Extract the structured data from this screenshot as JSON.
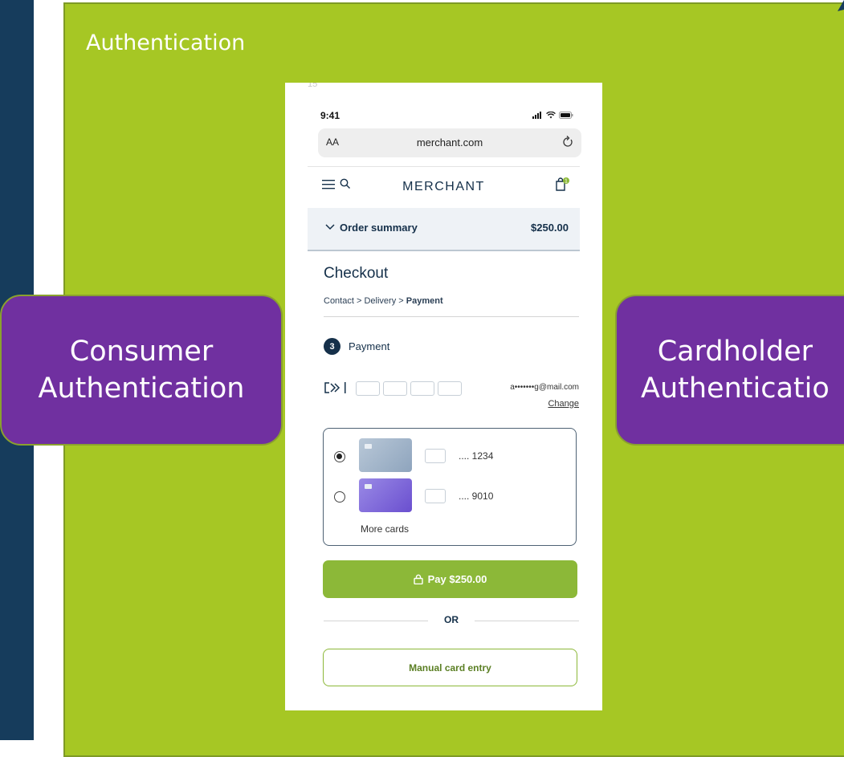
{
  "colors": {
    "left_band": "#163c5c",
    "panel": "#a6c724",
    "callout": "#7030a0",
    "pay_button": "#8cb838",
    "brand_text": "#15304a"
  },
  "slide": {
    "title": "Authentication",
    "left_callout": [
      "Consumer",
      "Authentication"
    ],
    "right_callout": [
      "Cardholder",
      "Authenticatio"
    ]
  },
  "phone": {
    "page_number": "15",
    "status_time": "9:41",
    "status_icons": [
      "signal-icon",
      "wifi-icon",
      "battery-icon"
    ],
    "url": {
      "aa": "AA",
      "domain": "merchant.com"
    },
    "header": {
      "logo": "MERCHANT"
    },
    "order_summary": {
      "label": "Order summary",
      "amount": "$250.00"
    },
    "checkout": {
      "title": "Checkout",
      "breadcrumb_1": "Contact",
      "breadcrumb_2": "Delivery",
      "breadcrumb_active": "Payment",
      "separator": ">"
    },
    "step": {
      "number": "3",
      "label": "Payment"
    },
    "click_to_pay": {
      "email": "a•••••••g@mail.com",
      "change": "Change"
    },
    "cards": [
      {
        "number": ".... 1234",
        "selected": true,
        "color": "#9fb3c9"
      },
      {
        "number": ".... 9010",
        "selected": false,
        "color": "#7f68d8"
      }
    ],
    "more_cards": "More cards",
    "pay_button": "Pay $250.00",
    "or": "OR",
    "manual_button": "Manual card entry"
  }
}
